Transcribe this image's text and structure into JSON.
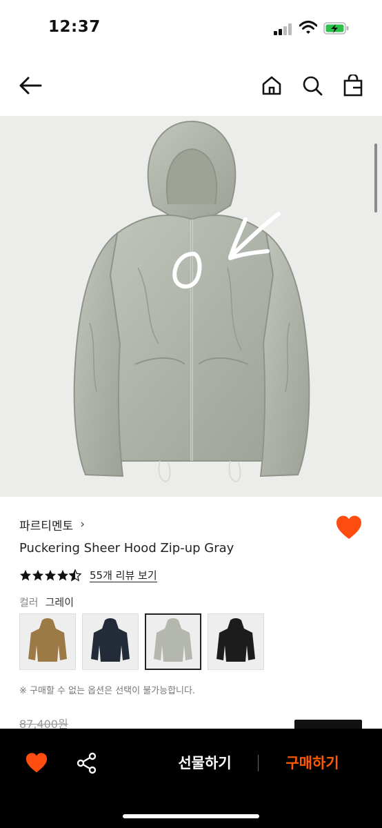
{
  "status": {
    "time": "12:37"
  },
  "nav": {
    "back_icon": "arrow-left-icon",
    "home_icon": "home-icon",
    "search_icon": "search-icon",
    "bag_icon": "shopping-bag-icon"
  },
  "product": {
    "brand": "파르티멘토",
    "brand_chevron": "›",
    "title": "Puckering Sheer Hood Zip-up Gray",
    "rating": 4.5,
    "review_link": "55개 리뷰 보기",
    "color_label": "컬러",
    "color_value": "그레이",
    "swatches": [
      {
        "name": "brown",
        "color": "#9b7a45"
      },
      {
        "name": "navy",
        "color": "#232a38"
      },
      {
        "name": "gray",
        "color": "#b3b7ae",
        "selected": true
      },
      {
        "name": "black",
        "color": "#1c1c1c"
      }
    ],
    "notice": "※ 구매할 수 없는 옵션은 선택이 불가능합니다.",
    "price_original": "87,400원"
  },
  "bottom_bar": {
    "gift_label": "선물하기",
    "buy_label": "구매하기"
  },
  "colors": {
    "accent": "#ff5a00",
    "heart": "#ff4d12",
    "hero_bg": "#ececeb"
  }
}
